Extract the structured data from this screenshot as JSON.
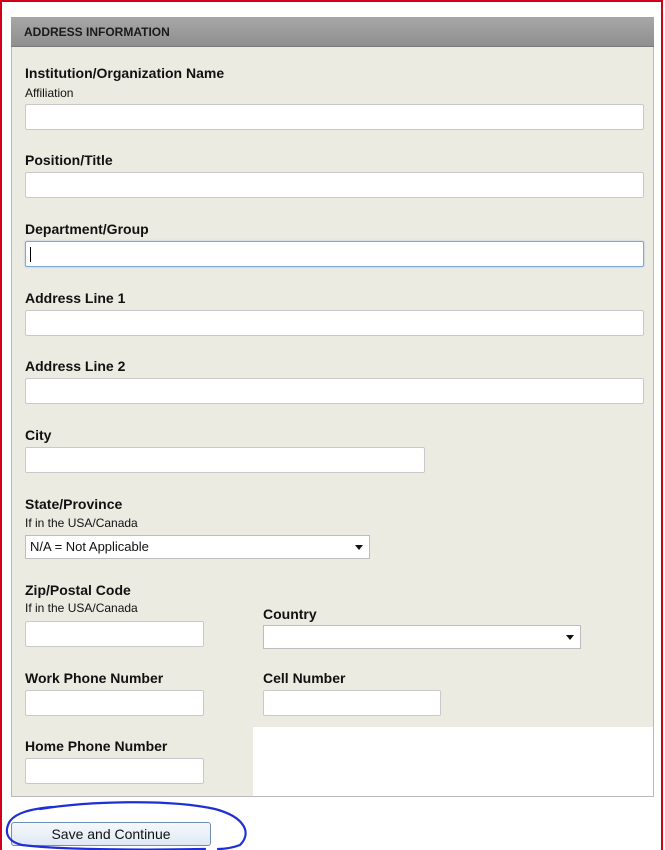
{
  "section_title": "ADDRESS INFORMATION",
  "fields": {
    "institution": {
      "label": "Institution/Organization Name",
      "sublabel": "Affiliation",
      "value": ""
    },
    "position": {
      "label": "Position/Title",
      "value": ""
    },
    "department": {
      "label": "Department/Group",
      "value": ""
    },
    "address1": {
      "label": "Address Line 1",
      "value": ""
    },
    "address2": {
      "label": "Address Line 2",
      "value": ""
    },
    "city": {
      "label": "City",
      "value": ""
    },
    "state": {
      "label": "State/Province",
      "sublabel": "If in the USA/Canada",
      "selected": "N/A = Not Applicable"
    },
    "zip": {
      "label": "Zip/Postal Code",
      "sublabel": "If in the USA/Canada",
      "value": ""
    },
    "country": {
      "label": "Country",
      "selected": ""
    },
    "work_phone": {
      "label": "Work Phone Number",
      "value": ""
    },
    "cell": {
      "label": "Cell Number",
      "value": ""
    },
    "home_phone": {
      "label": "Home Phone Number",
      "value": ""
    }
  },
  "save_button": "Save and Continue",
  "colors": {
    "frame": "#d0021b",
    "annotation": "#1f2fd6",
    "panel": "#ecebe2",
    "header": "#9b9b9b"
  }
}
